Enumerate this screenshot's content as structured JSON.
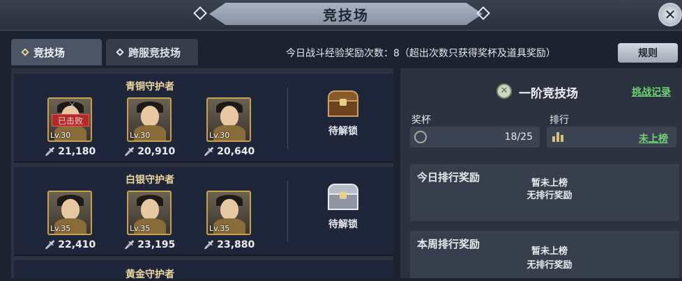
{
  "header": {
    "title": "竞技场",
    "close_icon": "close-icon"
  },
  "tabs": [
    {
      "label": "竞技场",
      "active": true
    },
    {
      "label": "跨服竞技场",
      "active": false
    }
  ],
  "info": {
    "daily_exp_text": "今日战斗经验奖励次数：8（超出次数只获得奖杯及道具奖励）",
    "rule_button": "规则"
  },
  "tiers": [
    {
      "name": "青铜守护者",
      "chest_label": "待解锁",
      "heroes": [
        {
          "level": "Lv.30",
          "power": "21,180",
          "status": "已击败"
        },
        {
          "level": "Lv.30",
          "power": "20,910",
          "status": ""
        },
        {
          "level": "Lv.30",
          "power": "20,640",
          "status": ""
        }
      ]
    },
    {
      "name": "白银守护者",
      "chest_label": "待解锁",
      "heroes": [
        {
          "level": "Lv.35",
          "power": "22,410",
          "status": ""
        },
        {
          "level": "Lv.35",
          "power": "23,195",
          "status": ""
        },
        {
          "level": "Lv.35",
          "power": "23,880",
          "status": ""
        }
      ]
    },
    {
      "name": "黄金守护者"
    }
  ],
  "rank_panel": {
    "title": "一阶竞技场",
    "record_link": "挑战记录",
    "trophy_label": "奖杯",
    "trophy_value": "18/25",
    "rank_label": "排行",
    "rank_value": "未上榜"
  },
  "rewards": [
    {
      "title": "今日排行奖励",
      "status": "暂未上榜",
      "reward": "无排行奖励"
    },
    {
      "title": "本周排行奖励",
      "status": "暂未上榜",
      "reward": "无排行奖励"
    }
  ]
}
